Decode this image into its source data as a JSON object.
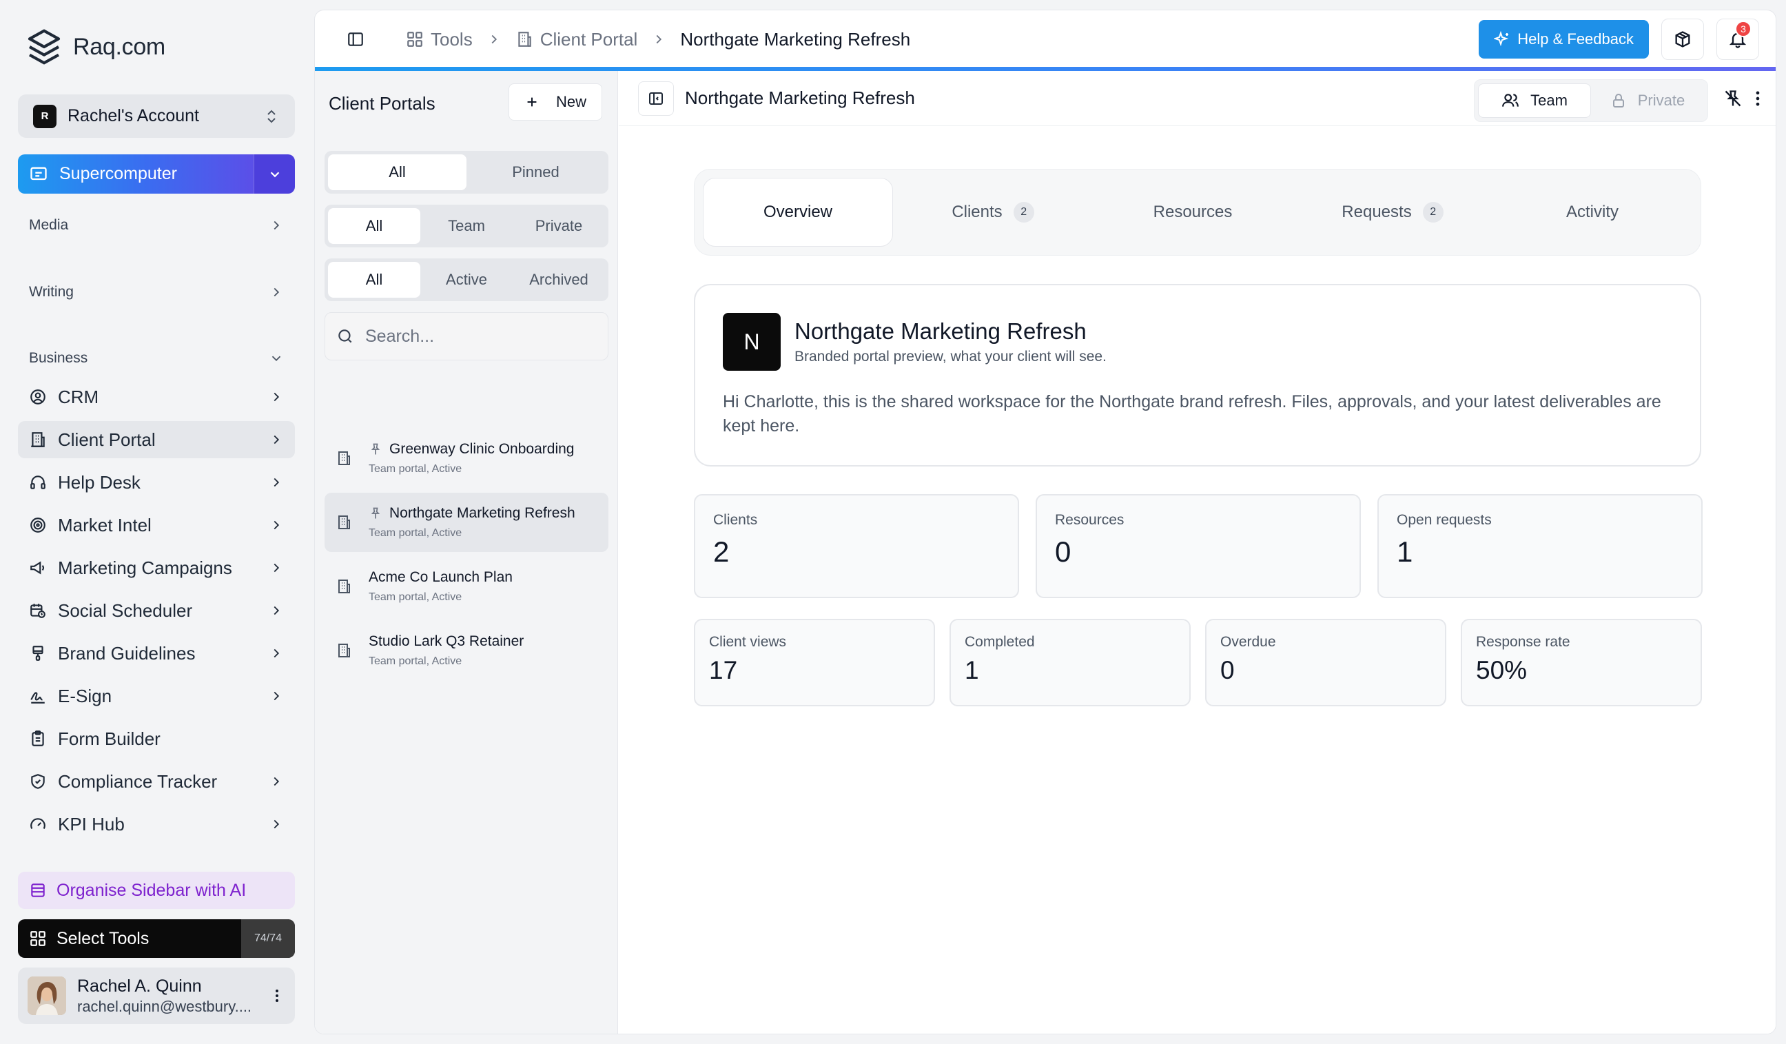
{
  "app": {
    "name": "Raq.com"
  },
  "account": {
    "initial": "R",
    "name": "Rachel's Account"
  },
  "supercomputer": {
    "label": "Supercomputer"
  },
  "sidebar": {
    "sections": [
      {
        "label": "Media"
      },
      {
        "label": "Writing"
      },
      {
        "label": "Business"
      }
    ],
    "items": [
      {
        "label": "CRM",
        "icon": "user-circle-icon"
      },
      {
        "label": "Client Portal",
        "icon": "building-icon"
      },
      {
        "label": "Help Desk",
        "icon": "headset-icon"
      },
      {
        "label": "Market Intel",
        "icon": "target-icon"
      },
      {
        "label": "Marketing Campaigns",
        "icon": "megaphone-icon"
      },
      {
        "label": "Social Scheduler",
        "icon": "calendar-clock-icon"
      },
      {
        "label": "Brand Guidelines",
        "icon": "paintbrush-icon"
      },
      {
        "label": "E-Sign",
        "icon": "signature-icon"
      },
      {
        "label": "Form Builder",
        "icon": "clipboard-icon"
      },
      {
        "label": "Compliance Tracker",
        "icon": "shield-check-icon"
      },
      {
        "label": "KPI Hub",
        "icon": "gauge-icon"
      }
    ],
    "organise_label": "Organise Sidebar with AI",
    "select_tools_label": "Select Tools",
    "select_tools_count": "74/74"
  },
  "user": {
    "name": "Rachel A. Quinn",
    "email": "rachel.quinn@westbury...."
  },
  "breadcrumb": {
    "tools": "Tools",
    "section": "Client Portal",
    "current": "Northgate Marketing Refresh"
  },
  "topbar": {
    "help_label": "Help & Feedback",
    "notification_count": "3"
  },
  "list": {
    "title": "Client Portals",
    "new_label": "New",
    "filter_pin": [
      "All",
      "Pinned"
    ],
    "filter_vis": [
      "All",
      "Team",
      "Private"
    ],
    "filter_status": [
      "All",
      "Active",
      "Archived"
    ],
    "search_placeholder": "Search...",
    "portals": [
      {
        "name": "Greenway Clinic Onboarding",
        "sub": "Team portal, Active",
        "pinned": true
      },
      {
        "name": "Northgate Marketing Refresh",
        "sub": "Team portal, Active",
        "pinned": true
      },
      {
        "name": "Acme Co Launch Plan",
        "sub": "Team portal, Active",
        "pinned": false
      },
      {
        "name": "Studio Lark Q3 Retainer",
        "sub": "Team portal, Active",
        "pinned": false
      }
    ]
  },
  "content": {
    "title": "Northgate Marketing Refresh",
    "visibility": [
      "Team",
      "Private"
    ],
    "tabs": [
      {
        "label": "Overview",
        "count": ""
      },
      {
        "label": "Clients",
        "count": "2"
      },
      {
        "label": "Resources",
        "count": ""
      },
      {
        "label": "Requests",
        "count": "2"
      },
      {
        "label": "Activity",
        "count": ""
      }
    ],
    "preview": {
      "initial": "N",
      "name": "Northgate Marketing Refresh",
      "subtitle": "Branded portal preview, what your client will see.",
      "message": "Hi Charlotte, this is the shared workspace for the Northgate brand refresh. Files, approvals, and your latest deliverables are kept here."
    },
    "stats": [
      {
        "label": "Clients",
        "value": "2"
      },
      {
        "label": "Resources",
        "value": "0"
      },
      {
        "label": "Open requests",
        "value": "1"
      }
    ],
    "metrics": [
      {
        "label": "Client views",
        "value": "17"
      },
      {
        "label": "Completed",
        "value": "1"
      },
      {
        "label": "Overdue",
        "value": "0"
      },
      {
        "label": "Response rate",
        "value": "50%"
      }
    ]
  },
  "colors": {
    "accent": "#1e90e8",
    "active_nav": "#e5e7eb",
    "purple": "#7e22ce"
  }
}
